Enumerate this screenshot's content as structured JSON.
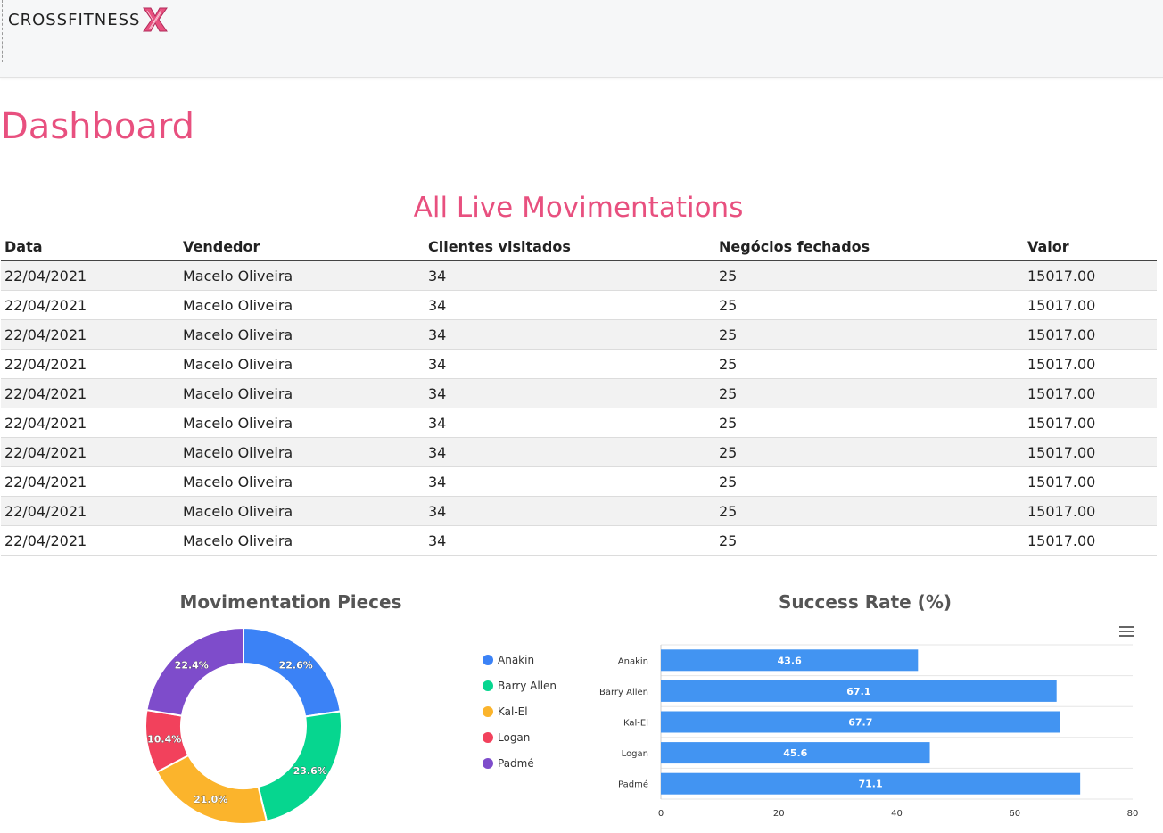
{
  "brand": {
    "name": "CROSSFITNESS"
  },
  "page": {
    "title": "Dashboard"
  },
  "movements": {
    "title": "All Live Movimentations",
    "columns": [
      "Data",
      "Vendedor",
      "Clientes visitados",
      "Negócios fechados",
      "Valor"
    ],
    "rows": [
      [
        "22/04/2021",
        "Macelo Oliveira",
        "34",
        "25",
        "15017.00"
      ],
      [
        "22/04/2021",
        "Macelo Oliveira",
        "34",
        "25",
        "15017.00"
      ],
      [
        "22/04/2021",
        "Macelo Oliveira",
        "34",
        "25",
        "15017.00"
      ],
      [
        "22/04/2021",
        "Macelo Oliveira",
        "34",
        "25",
        "15017.00"
      ],
      [
        "22/04/2021",
        "Macelo Oliveira",
        "34",
        "25",
        "15017.00"
      ],
      [
        "22/04/2021",
        "Macelo Oliveira",
        "34",
        "25",
        "15017.00"
      ],
      [
        "22/04/2021",
        "Macelo Oliveira",
        "34",
        "25",
        "15017.00"
      ],
      [
        "22/04/2021",
        "Macelo Oliveira",
        "34",
        "25",
        "15017.00"
      ],
      [
        "22/04/2021",
        "Macelo Oliveira",
        "34",
        "25",
        "15017.00"
      ],
      [
        "22/04/2021",
        "Macelo Oliveira",
        "34",
        "25",
        "15017.00"
      ]
    ]
  },
  "colors": {
    "accent": "#e8507f",
    "series": [
      "#3b82f6",
      "#06d68f",
      "#fbb42c",
      "#f2415c",
      "#7e4ccb"
    ],
    "bar": "#4294f2"
  },
  "chart_data": [
    {
      "type": "pie",
      "title": "Movimentation Pieces",
      "categories": [
        "Anakin",
        "Barry Allen",
        "Kal-El",
        "Logan",
        "Padmé"
      ],
      "values": [
        22.6,
        23.6,
        21.0,
        10.4,
        22.4
      ],
      "data_labels": [
        "22.6%",
        "23.6%",
        "21.0%",
        "10.4%",
        "22.4%"
      ],
      "legend": "right"
    },
    {
      "type": "bar",
      "orientation": "horizontal",
      "title": "Success Rate (%)",
      "categories": [
        "Anakin",
        "Barry Allen",
        "Kal-El",
        "Logan",
        "Padmé"
      ],
      "values": [
        43.6,
        67.1,
        67.7,
        45.6,
        71.1
      ],
      "xlim": [
        0,
        80
      ],
      "ticks": [
        "0",
        "20",
        "40",
        "60",
        "80"
      ],
      "grid": true
    }
  ]
}
